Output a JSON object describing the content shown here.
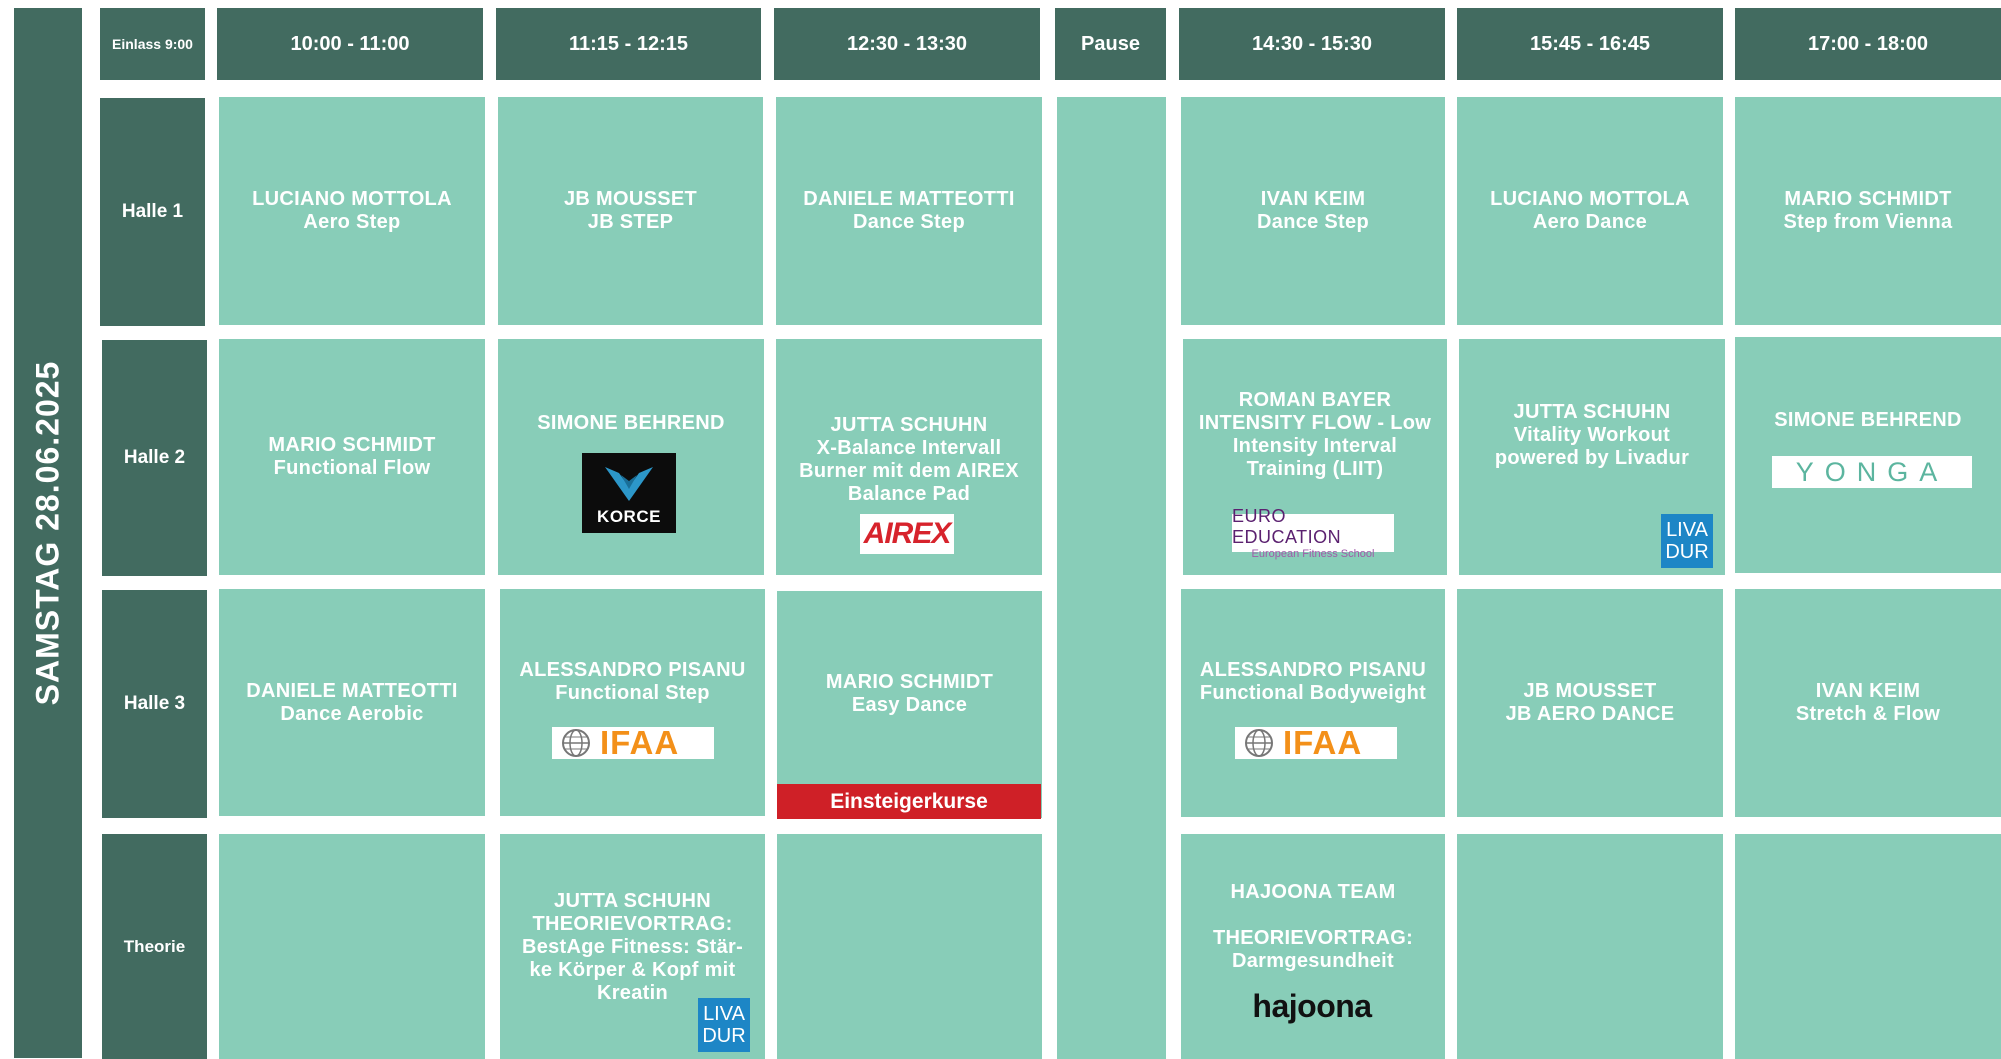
{
  "day": "SAMSTAG 28.06.2025",
  "entry": "Einlass 9:00",
  "pause": "Pause",
  "times": [
    "10:00 - 11:00",
    "11:15 - 12:15",
    "12:30 - 13:30",
    "14:30 - 15:30",
    "15:45 - 16:45",
    "17:00 - 18:00"
  ],
  "halls": [
    "Halle 1",
    "Halle 2",
    "Halle 3",
    "Theorie"
  ],
  "sessions": {
    "h1": [
      {
        "trainer": "LUCIANO MOTTOLA",
        "title": "Aero Step"
      },
      {
        "trainer": "JB MOUSSET",
        "title": "JB STEP"
      },
      {
        "trainer": "DANIELE MATTEOTTI",
        "title": "Dance Step"
      },
      {
        "trainer": "IVAN KEIM",
        "title": "Dance Step"
      },
      {
        "trainer": "LUCIANO MOTTOLA",
        "title": "Aero Dance"
      },
      {
        "trainer": "MARIO SCHMIDT",
        "title": "Step from Vienna"
      }
    ],
    "h2": [
      {
        "trainer": "MARIO SCHMIDT",
        "title": "Functional Flow"
      },
      {
        "trainer": "SIMONE BEHREND",
        "title": ""
      },
      {
        "trainer": "JUTTA SCHUHN",
        "title": "X-Balance Intervall Burner mit dem AIREX Balance Pad"
      },
      {
        "trainer": "ROMAN BAYER",
        "title": "INTENSITY FLOW - Low Intensity Interval Training (LIIT)"
      },
      {
        "trainer": "JUTTA SCHUHN",
        "title": "Vitality Workout powered by Livadur"
      },
      {
        "trainer": "SIMONE BEHREND",
        "title": ""
      }
    ],
    "h3": [
      {
        "trainer": "DANIELE MATTEOTTI",
        "title": "Dance Aerobic"
      },
      {
        "trainer": "ALESSANDRO PISANU",
        "title": "Functional Step"
      },
      {
        "trainer": "MARIO SCHMIDT",
        "title": "Easy Dance"
      },
      {
        "trainer": "ALESSANDRO PISANU",
        "title": "Functional Bodyweight"
      },
      {
        "trainer": "JB MOUSSET",
        "title": "JB AERO DANCE"
      },
      {
        "trainer": "IVAN KEIM",
        "title": "Stretch & Flow"
      }
    ],
    "th": [
      {
        "trainer": "",
        "title": ""
      },
      {
        "trainer": "JUTTA SCHUHN",
        "title": "THEORIEVORTRAG: BestAge Fitness: Stär-ke Körper & Kopf mit Kreatin"
      },
      {
        "trainer": "",
        "title": ""
      },
      {
        "trainer": "HAJOONA TEAM",
        "title": "THEORIEVORTRAG: Darmgesundheit"
      },
      {
        "trainer": "",
        "title": ""
      },
      {
        "trainer": "",
        "title": ""
      }
    ]
  },
  "badge": "Einsteigerkurse",
  "logos": {
    "korce": "KORCE",
    "airex": "AIREX",
    "ifaa": "IFAA",
    "euro_line1": "EURO EDUCATION",
    "euro_line2": "European Fitness School",
    "livadur_line1": "LIVA",
    "livadur_line2": "DUR",
    "yonga": "YONGA",
    "hajoona": "hajoona"
  },
  "colors": {
    "dark_green": "#426b60",
    "cell_green": "#88cdb8",
    "badge_red": "#cf2027",
    "ifaa_orange": "#f39019",
    "livadur_blue": "#1d86c6"
  }
}
